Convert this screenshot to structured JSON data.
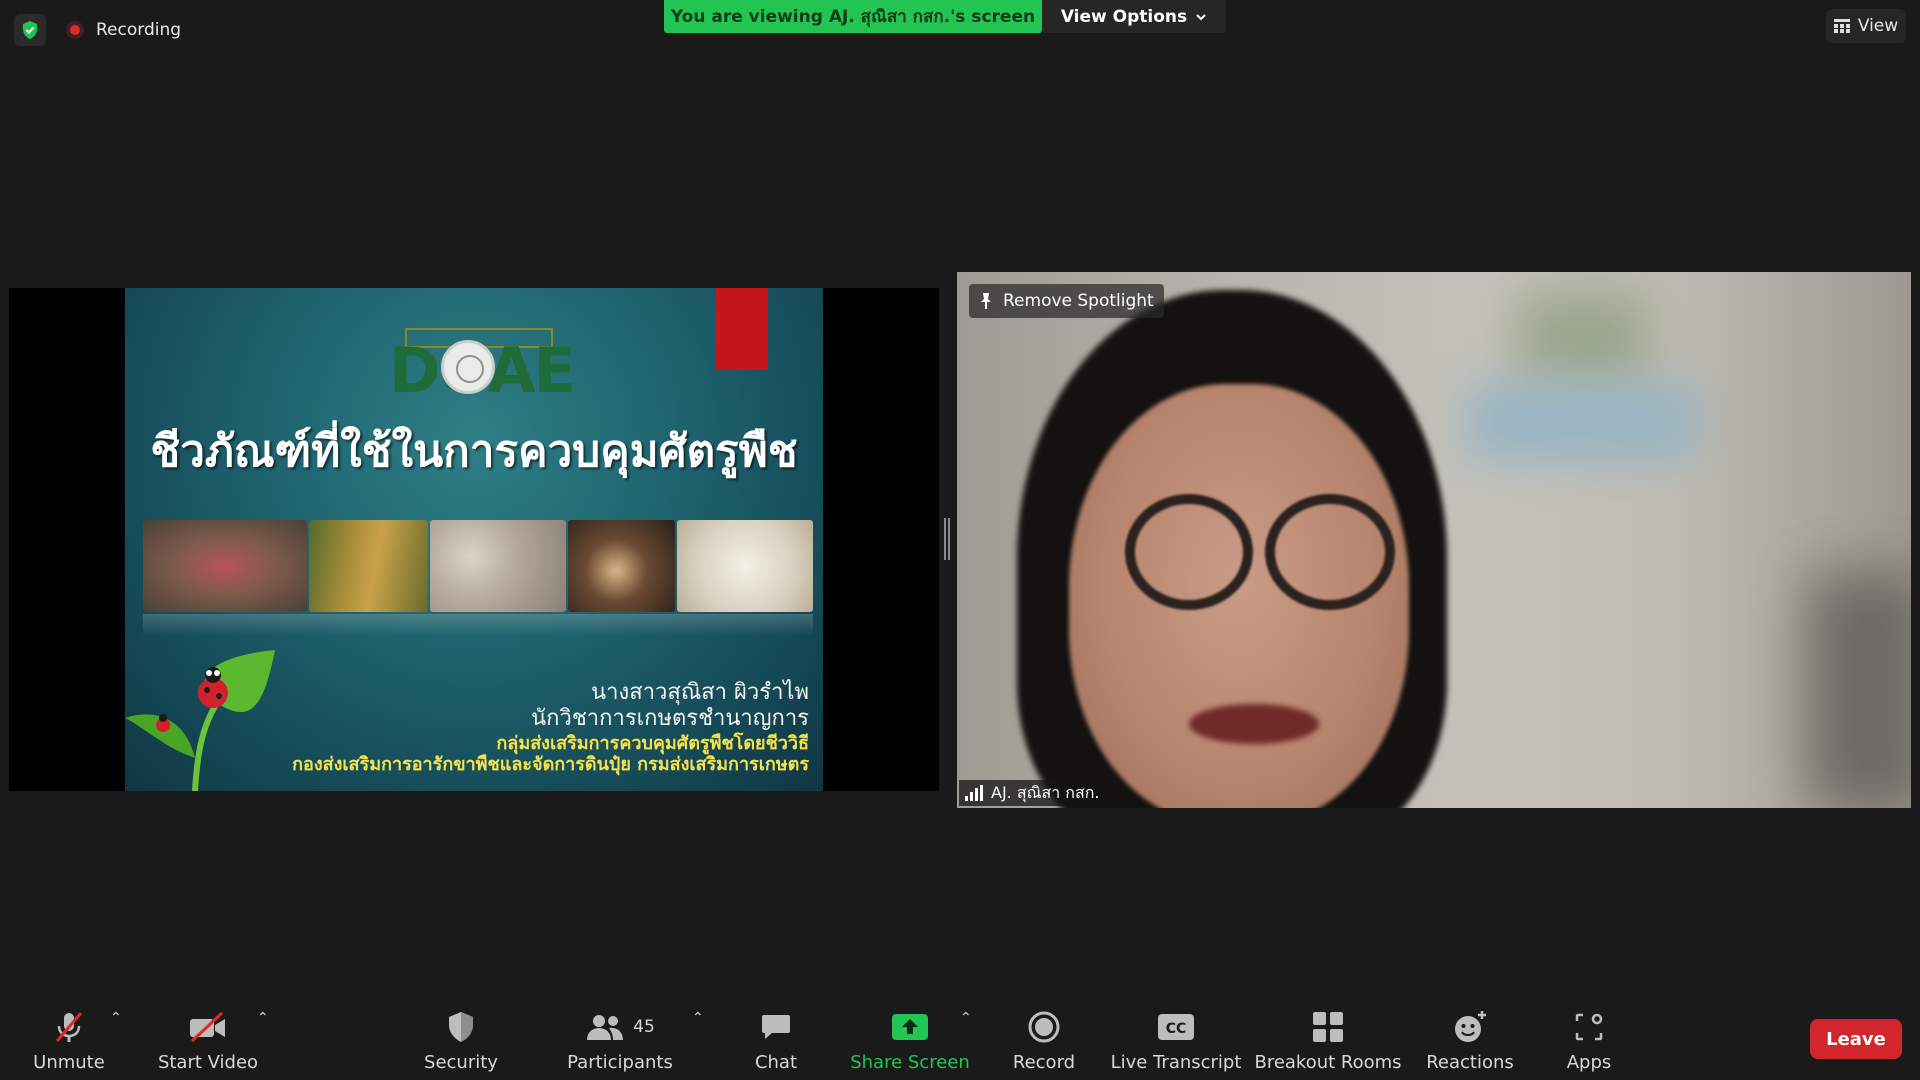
{
  "top_bar": {
    "recording_label": "Recording",
    "viewing_banner": "You are viewing AJ. สุณิสา กสก.'s screen",
    "view_options_label": "View Options",
    "view_label": "View"
  },
  "shared_slide": {
    "logo_text": "DOAE",
    "title": "ชีวภัณฑ์ที่ใช้ในการควบคุมศัตรูพืช",
    "presenter_name": "นางสาวสุณิสา ผิวรำไพ",
    "presenter_position": "นักวิชาการเกษตรชำนาญการ",
    "presenter_group": "กลุ่มส่งเสริมการควบคุมศัตรูพืชโดยชีววิธี",
    "presenter_division": "กองส่งเสริมการอารักขาพืชและจัดการดินปุ๋ย กรมส่งเสริมการเกษตร"
  },
  "video": {
    "spotlight_label": "Remove Spotlight",
    "participant_name": "AJ. สุณิสา กสก."
  },
  "toolbar": {
    "unmute": "Unmute",
    "start_video": "Start Video",
    "security": "Security",
    "participants": "Participants",
    "participants_count": "45",
    "chat": "Chat",
    "share_screen": "Share Screen",
    "record": "Record",
    "live_transcript": "Live Transcript",
    "live_transcript_icon_text": "CC",
    "breakout_rooms": "Breakout Rooms",
    "reactions": "Reactions",
    "apps": "Apps",
    "leave": "Leave"
  },
  "colors": {
    "banner_green": "#23c552",
    "share_screen_green": "#23c552",
    "leave_red": "#d1262b",
    "recording_red": "#e02828",
    "slide_yellow": "#f6e24a"
  }
}
